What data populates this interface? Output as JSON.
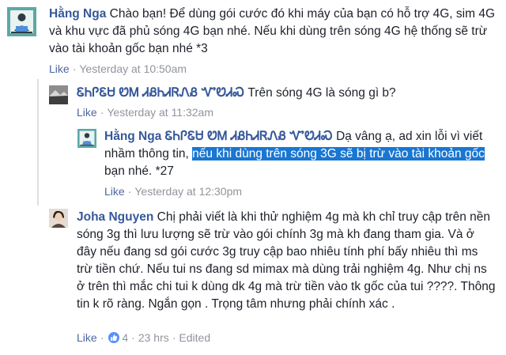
{
  "comments": [
    {
      "author": "Hằng Nga",
      "text": "Chào bạn! Để dùng gói cước đó khi máy của bạn có hỗ trợ 4G, sim 4G và khu vực đã phủ sóng 4G bạn nhé. Nếu khi dùng trên sóng 4G hệ thống sẽ trừ vào tài khoản gốc bạn nhé *3",
      "like_label": "Like",
      "timestamp": "Yesterday at 10:50am"
    },
    {
      "author": "ᏋᏂᎵᏋᏌ ᏬᎷ ᏗᏰᏂᏗᏒᏁᏰ ᏉᏬᏗᏍ",
      "text": "Trên sóng 4G là sóng gì b?",
      "like_label": "Like",
      "timestamp": "Yesterday at 11:32am"
    },
    {
      "author": "Hằng Nga",
      "mention": "ᏋᏂᎵᏋᏌ ᏬᎷ ᏗᏰᏂᏗᏒᏁᏰ ᏉᏬᏗᏍ",
      "text_before": "Dạ vâng ạ, ad xin lỗi vì viết nhầm thông tin,",
      "text_highlight": "nếu khi dùng trên sóng 3G sẽ bị trừ vào tài khoản gốc",
      "text_after": "bạn nhé. *27",
      "like_label": "Like",
      "timestamp": "Yesterday at 12:30pm"
    },
    {
      "author": "Joha Nguyen",
      "text": "Chị phải viết là khi thử nghiệm 4g mà kh chỉ truy cập trên nền sóng 3g thì lưu lượng sẽ trừ vào gói chính 3g mà kh đang tham gia. Và ở đây nếu đang sd gói cước 3g truy cập bao nhiêu tính phí bấy nhiêu thì ms trừ tiền chứ. Nếu tui ns đang sd mimax mà dùng trải nghiệm 4g. Như chị ns ở trên thì mắc chi tui k dùng dk 4g mà trừ tiền vào tk gốc của tui ????. Thông tin k rõ ràng. Ngắn gọn . Trọng tâm nhưng phải chính xác .",
      "like_label": "Like",
      "reaction_count": "4",
      "timestamp": "23 hrs",
      "edited_label": "Edited"
    }
  ],
  "colors": {
    "link": "#365899",
    "meta": "#90949c",
    "highlight": "#1976d2",
    "reaction": "#5890ff"
  }
}
